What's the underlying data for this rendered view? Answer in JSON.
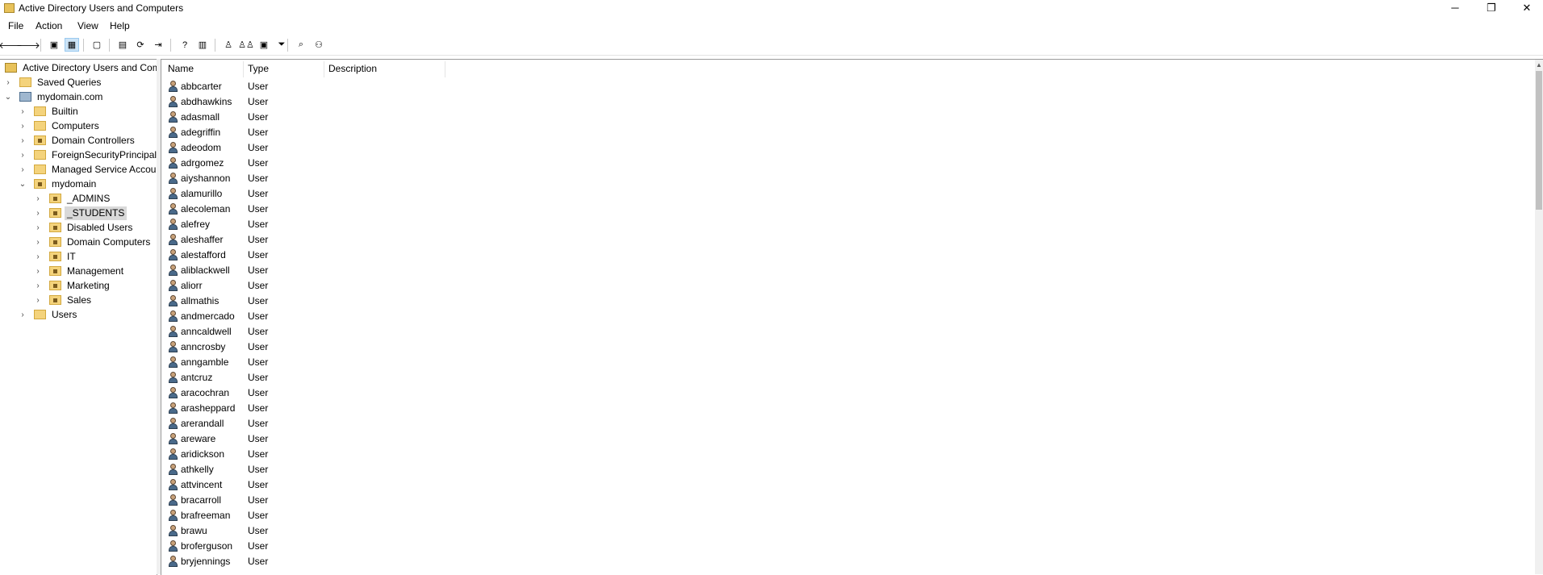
{
  "window": {
    "title": "Active Directory Users and Computers",
    "controls": {
      "minimize": "─",
      "maximize": "❐",
      "close": "✕"
    }
  },
  "menu": [
    "File",
    "Action",
    "View",
    "Help"
  ],
  "toolbar": {
    "buttons": [
      {
        "name": "back-icon",
        "glyph": "🡐"
      },
      {
        "name": "forward-icon",
        "glyph": "🡒"
      },
      {
        "name": "up-folder-icon",
        "glyph": "▣"
      },
      {
        "name": "show-hide-tree-icon",
        "glyph": "▦"
      },
      {
        "name": "clipboard-icon",
        "glyph": "▢"
      },
      {
        "name": "properties-icon",
        "glyph": "▤"
      },
      {
        "name": "refresh-icon",
        "glyph": "⟳"
      },
      {
        "name": "export-list-icon",
        "glyph": "⇥"
      },
      {
        "name": "help-icon",
        "glyph": "?"
      },
      {
        "name": "view-icon",
        "glyph": "▥"
      },
      {
        "name": "new-user-icon",
        "glyph": "♙"
      },
      {
        "name": "new-group-icon",
        "glyph": "♙♙"
      },
      {
        "name": "new-ou-icon",
        "glyph": "▣"
      },
      {
        "name": "filter-icon",
        "glyph": "⏷"
      },
      {
        "name": "find-icon",
        "glyph": "⌕"
      },
      {
        "name": "add-to-group-icon",
        "glyph": "⚇"
      }
    ]
  },
  "tree": {
    "root": "Active Directory Users and Com",
    "saved_queries": "Saved Queries",
    "domain": "mydomain.com",
    "containers": [
      "Builtin",
      "Computers",
      "Domain Controllers",
      "ForeignSecurityPrincipals",
      "Managed Service Accour"
    ],
    "ou_mydomain": "mydomain",
    "children": [
      "_ADMINS",
      "_STUDENTS",
      "Disabled Users",
      "Domain Computers",
      "IT",
      "Management",
      "Marketing",
      "Sales"
    ],
    "selected": "_STUDENTS",
    "users": "Users",
    "caret_collapsed": "›",
    "caret_expanded": "⌄"
  },
  "list": {
    "columns": [
      "Name",
      "Type",
      "Description"
    ],
    "type_value": "User",
    "rows": [
      "abbcarter",
      "abdhawkins",
      "adasmall",
      "adegriffin",
      "adeodom",
      "adrgomez",
      "aiyshannon",
      "alamurillo",
      "alecoleman",
      "alefrey",
      "aleshaffer",
      "alestafford",
      "aliblackwell",
      "aliorr",
      "allmathis",
      "andmercado",
      "anncaldwell",
      "anncrosby",
      "anngamble",
      "antcruz",
      "aracochran",
      "arasheppard",
      "arerandall",
      "areware",
      "aridickson",
      "athkelly",
      "attvincent",
      "bracarroll",
      "brafreeman",
      "brawu",
      "broferguson",
      "bryjennings"
    ]
  },
  "scrollbar": {
    "up_glyph": "▲"
  }
}
